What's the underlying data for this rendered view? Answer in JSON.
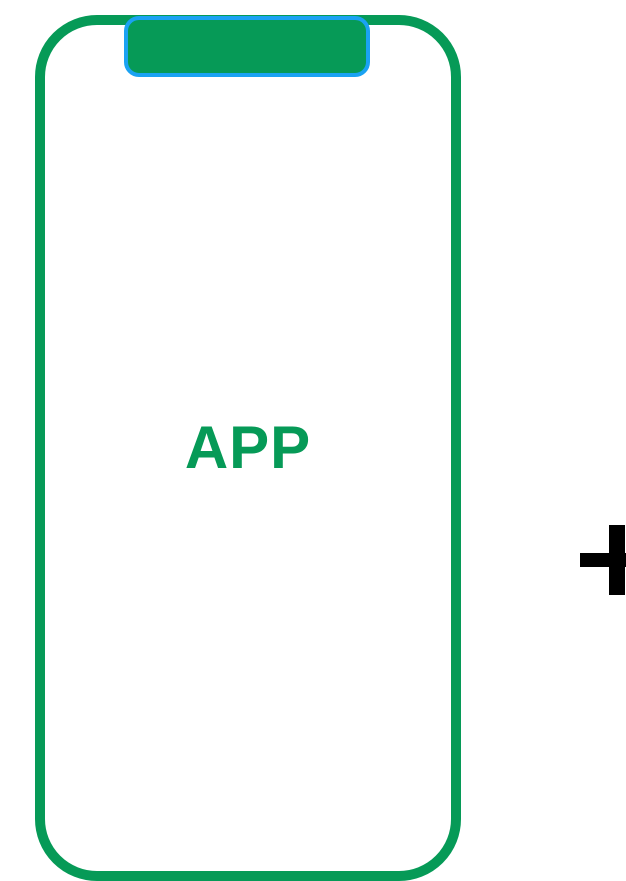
{
  "phone": {
    "app_label": "APP",
    "frame_color": "#069a57",
    "notch_fill_color": "#069a57",
    "notch_border_color": "#1aa2f2"
  },
  "operator": {
    "icon": "plus-icon",
    "color": "#000000"
  }
}
